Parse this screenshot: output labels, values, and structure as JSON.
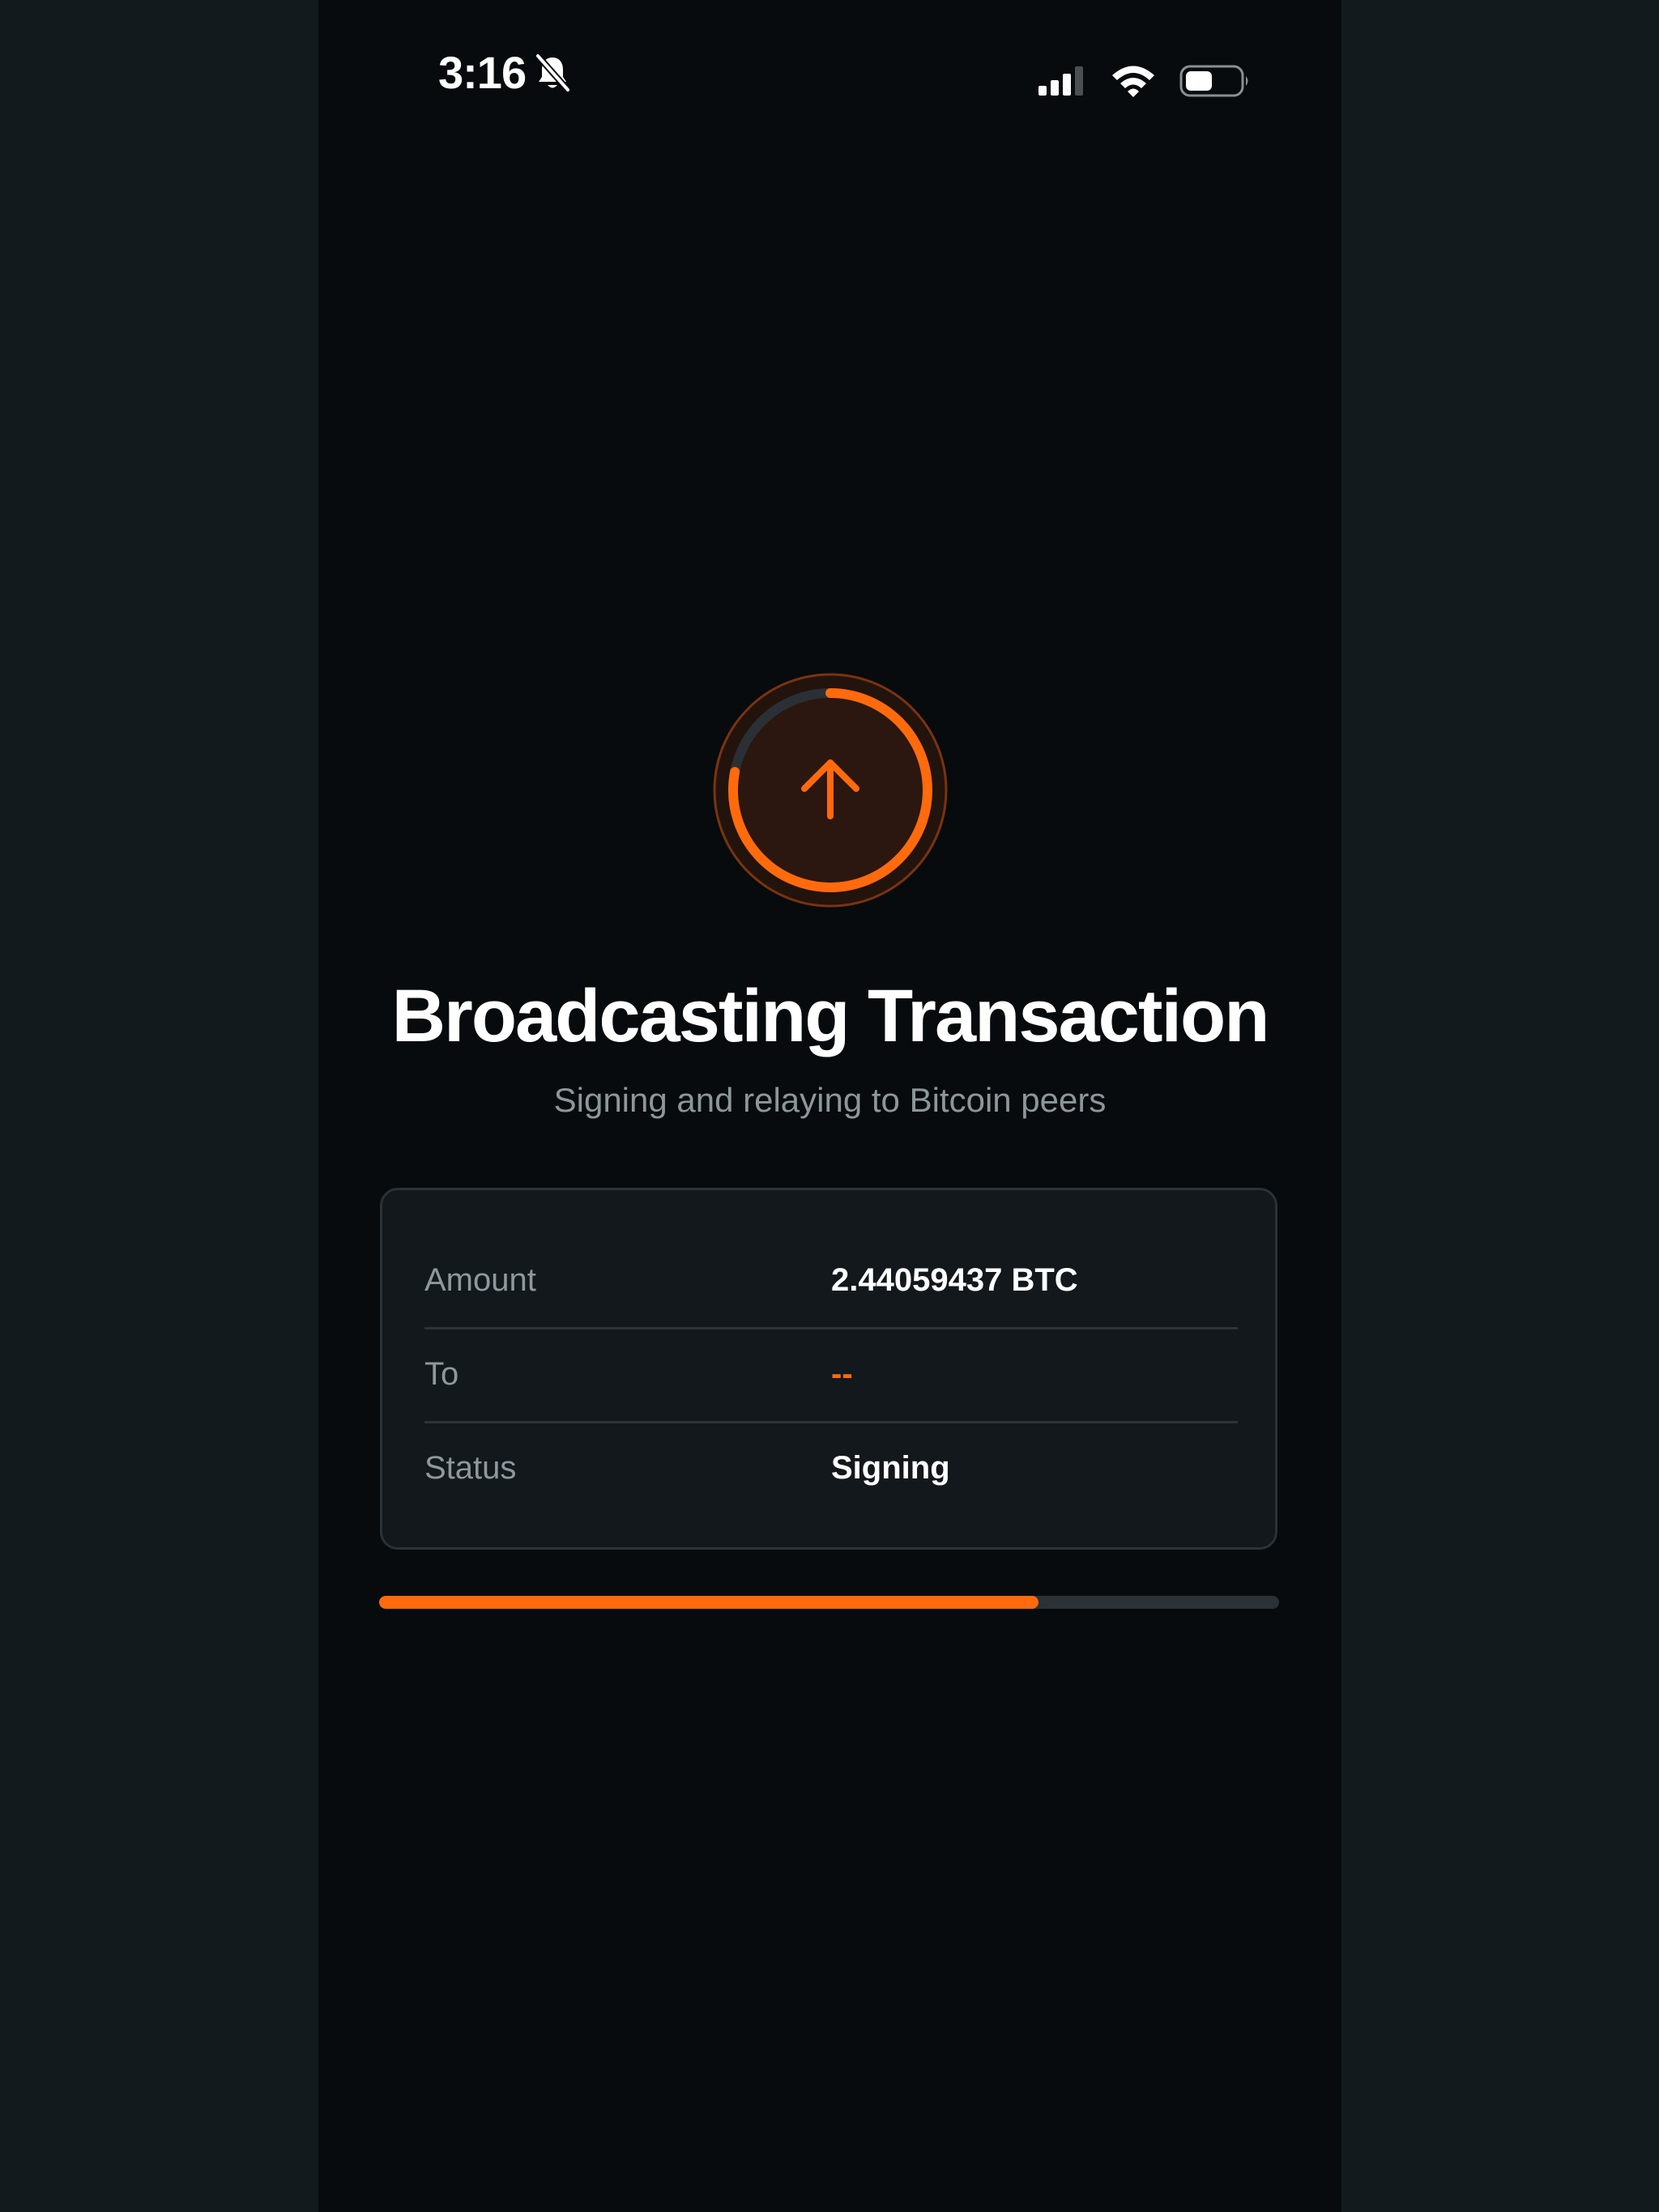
{
  "status_bar": {
    "time": "3:16",
    "icons": [
      "bell-slash-icon",
      "cellular-signal-icon",
      "wifi-icon",
      "battery-icon"
    ]
  },
  "spinner": {
    "icon": "arrow-up-icon",
    "progress": 0.78
  },
  "title": "Broadcasting Transaction",
  "subtitle": "Signing and relaying to Bitcoin peers",
  "details": {
    "amount_label": "Amount",
    "amount_value": "2.44059437 BTC",
    "to_label": "To",
    "to_value": "--",
    "status_label": "Status",
    "status_value": "Signing"
  },
  "progress": {
    "fraction": 0.733
  },
  "colors": {
    "accent": "#ff6a0d",
    "background": "#070b0d",
    "surround": "#121a1e",
    "card": "#12181c",
    "muted_text": "#8c979b",
    "track": "#2a3237"
  }
}
